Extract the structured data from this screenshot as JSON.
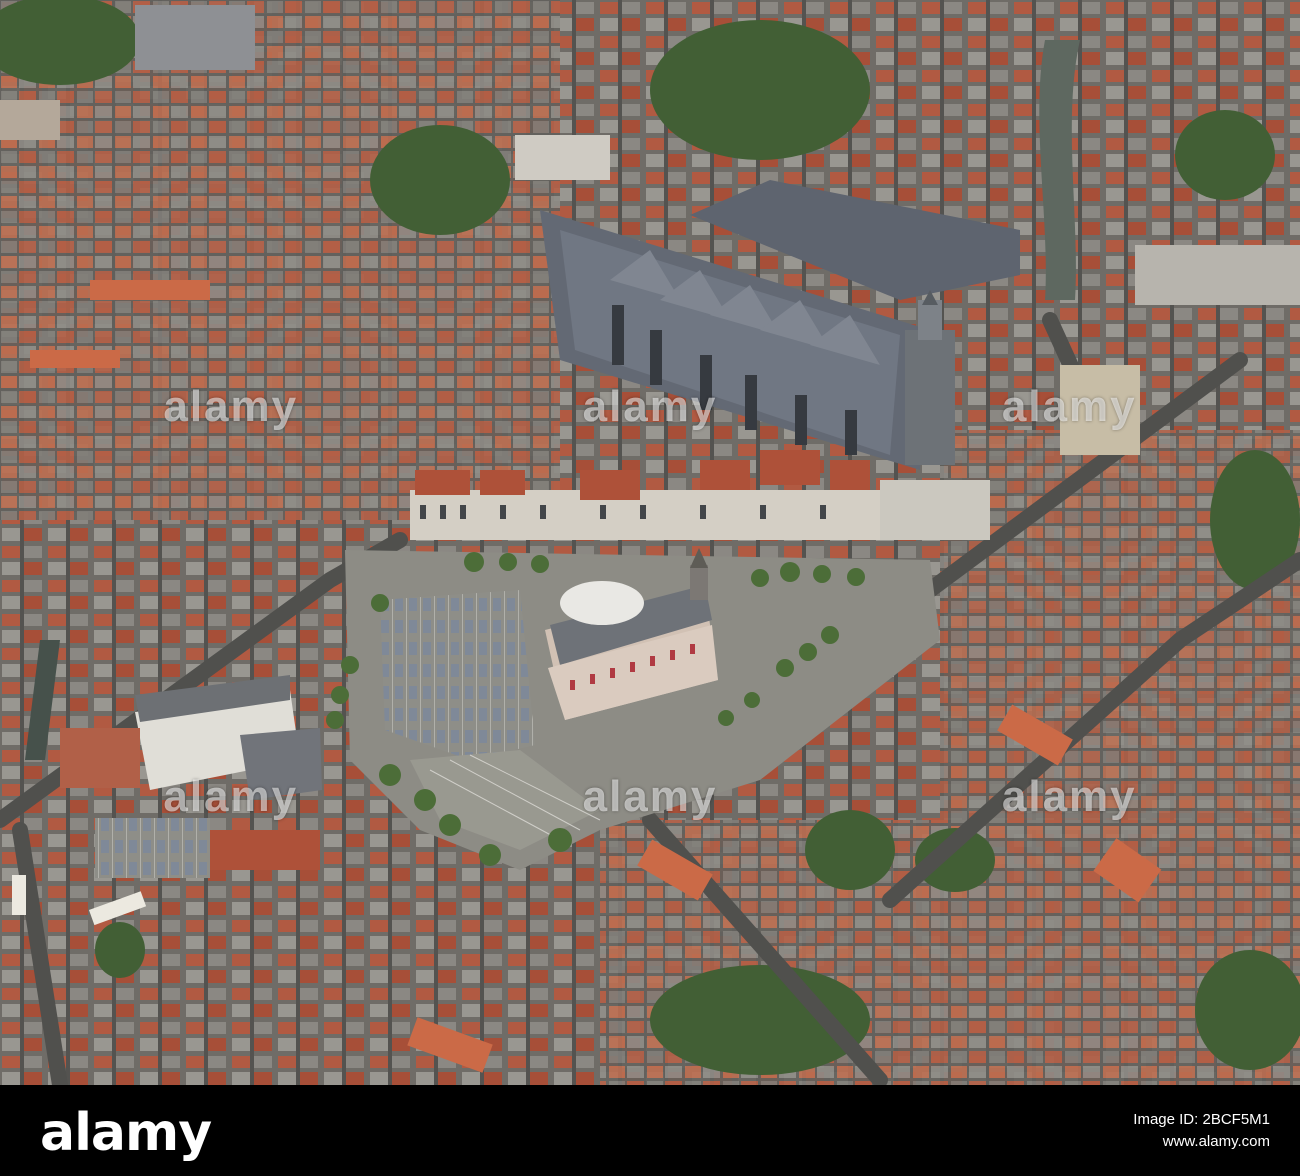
{
  "watermark": {
    "brand": "alamy"
  },
  "footer": {
    "brand": "alamy",
    "image_id_label": "Image ID: 2BCF5M1",
    "site": "www.alamy.com"
  },
  "colors": {
    "roof_red": "#b4543a",
    "roof_slate": "#5f6470",
    "square_paving": "#8c8a83",
    "tree_green": "#3b5a2c",
    "canal": "#59635b",
    "city_hall_facade": "#d6c4b6"
  }
}
